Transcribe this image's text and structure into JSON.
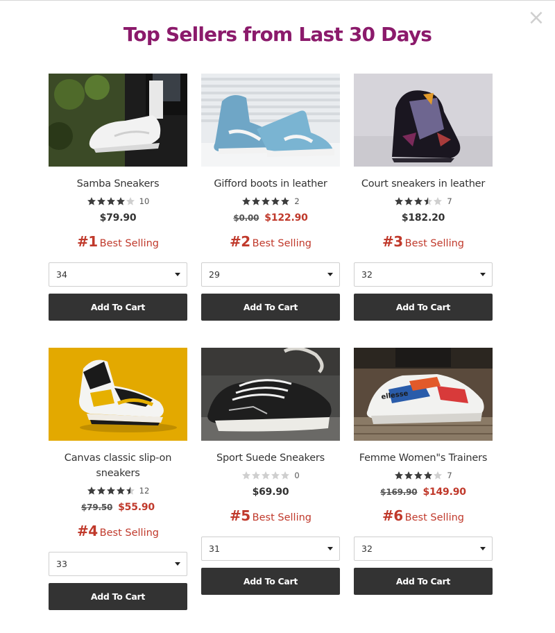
{
  "modal": {
    "title": "Top Sellers from Last 30 Days",
    "close_label": "×",
    "title_color": "#8b1a6b",
    "accent_color": "#c0392b",
    "button_color": "#333333"
  },
  "products": [
    {
      "name": "Samba Sneakers",
      "rating": 4,
      "rating_count": "10",
      "old_price": "",
      "price": "$79.90",
      "on_sale": false,
      "rank": "#1",
      "rank_label": "Best Selling",
      "size": "34",
      "cart_label": "Add To Cart",
      "image_icon": "white-sneaker-photo"
    },
    {
      "name": "Gifford boots in leather",
      "rating": 5,
      "rating_count": "2",
      "old_price": "$0.00",
      "price": "$122.90",
      "on_sale": true,
      "rank": "#2",
      "rank_label": "Best Selling",
      "size": "29",
      "cart_label": "Add To Cart",
      "image_icon": "blue-hightop-photo"
    },
    {
      "name": "Court sneakers in leather",
      "rating": 3.5,
      "rating_count": "7",
      "old_price": "",
      "price": "$182.20",
      "on_sale": false,
      "rank": "#3",
      "rank_label": "Best Selling",
      "size": "32",
      "cart_label": "Add To Cart",
      "image_icon": "purple-jordan-photo"
    },
    {
      "name": "Canvas classic slip-on sneakers",
      "rating": 4.5,
      "rating_count": "12",
      "old_price": "$79.50",
      "price": "$55.90",
      "on_sale": true,
      "rank": "#4",
      "rank_label": "Best Selling",
      "size": "33",
      "cart_label": "Add To Cart",
      "image_icon": "yellow-jordan-photo"
    },
    {
      "name": "Sport Suede Sneakers",
      "rating": 0,
      "rating_count": "0",
      "old_price": "",
      "price": "$69.90",
      "on_sale": false,
      "rank": "#5",
      "rank_label": "Best Selling",
      "size": "31",
      "cart_label": "Add To Cart",
      "image_icon": "black-canvas-sneaker-photo"
    },
    {
      "name": "Femme Women\"s Trainers",
      "rating": 4,
      "rating_count": "7",
      "old_price": "$169.90",
      "price": "$149.90",
      "on_sale": true,
      "rank": "#6",
      "rank_label": "Best Selling",
      "size": "32",
      "cart_label": "Add To Cart",
      "image_icon": "ellesse-trainer-photo"
    }
  ]
}
